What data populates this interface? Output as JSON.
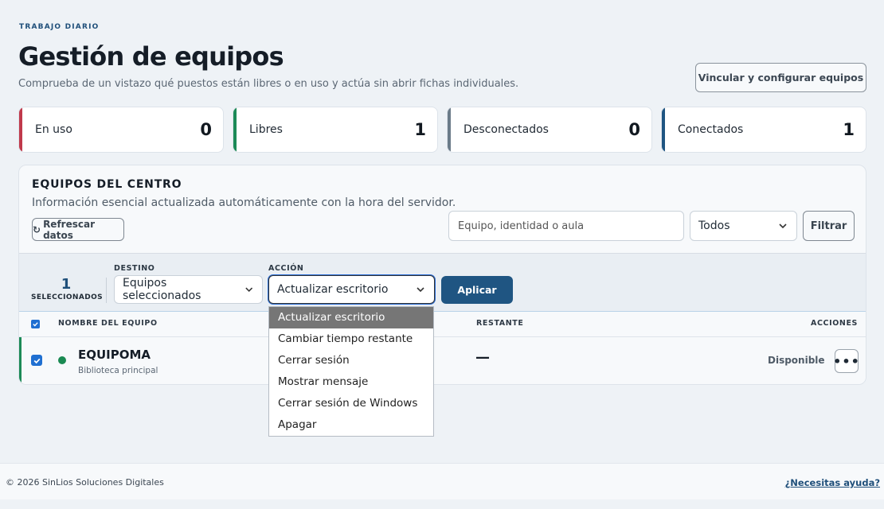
{
  "header": {
    "eyebrow": "TRABAJO DIARIO",
    "title": "Gestión de equipos",
    "subtitle": "Comprueba de un vistazo qué puestos están libres o en uso y actúa sin abrir fichas individuales.",
    "link_button": "Vincular y configurar equipos"
  },
  "stats": [
    {
      "label": "En uso",
      "value": "0",
      "color": "#c0394b"
    },
    {
      "label": "Libres",
      "value": "1",
      "color": "#1c8a57"
    },
    {
      "label": "Desconectados",
      "value": "0",
      "color": "#6b7b89"
    },
    {
      "label": "Conectados",
      "value": "1",
      "color": "#1f5582"
    }
  ],
  "panel": {
    "title": "EQUIPOS DEL CENTRO",
    "subtitle": "Información esencial actualizada automáticamente con la hora del servidor.",
    "refresh_label": "Refrescar datos",
    "search_placeholder": "Equipo, identidad o aula",
    "filter_select": "Todos",
    "filter_button": "Filtrar"
  },
  "bulk": {
    "count": "1",
    "count_label": "SELECCIONADOS",
    "destination_caption": "DESTINO",
    "destination_value": "Equipos seleccionados",
    "action_caption": "ACCIÓN",
    "action_value": "Actualizar escritorio",
    "apply_label": "Aplicar"
  },
  "table": {
    "col_name": "NOMBRE DEL EQUIPO",
    "col_remaining": "RESTANTE",
    "col_actions": "ACCIONES",
    "rows": [
      {
        "name": "EQUIPOMA",
        "location": "Biblioteca principal",
        "remaining": "—",
        "status": "Disponible",
        "status_color": "#1a8a52"
      }
    ]
  },
  "action_menu": {
    "items": [
      "Actualizar escritorio",
      "Cambiar tiempo restante",
      "Cerrar sesión",
      "Mostrar mensaje",
      "Cerrar sesión de Windows",
      "Apagar"
    ],
    "selected": "Actualizar escritorio"
  },
  "footer": {
    "copyright": "© 2026 SinLios Soluciones Digitales",
    "help_link": "¿Necesitas ayuda?"
  }
}
